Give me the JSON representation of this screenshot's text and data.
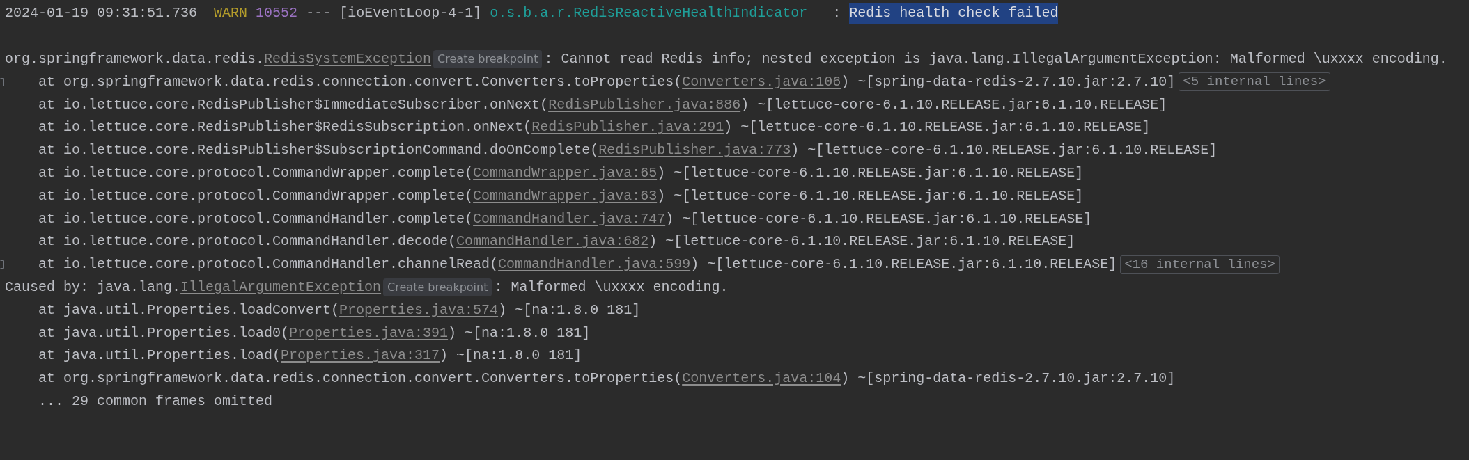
{
  "header": {
    "timestamp": "2024-01-19 09:31:51.736",
    "level": "WARN",
    "pid": "10552",
    "separator": "---",
    "thread": "[ioEventLoop-4-1]",
    "logger": "o.s.b.a.r.RedisReactiveHealthIndicator",
    "colon": ":",
    "message": "Redis health check failed",
    "message_selected": true
  },
  "lines": [
    {
      "kind": "exception",
      "prefix": "org.springframework.data.redis.",
      "class_link": "RedisSystemException",
      "hint": "Create breakpoint",
      "rest": ": Cannot read Redis info; nested exception is java.lang.IllegalArgumentException: Malformed \\uxxxx encoding."
    },
    {
      "kind": "frame",
      "fold_marker": true,
      "text": "at org.springframework.data.redis.connection.convert.Converters.toProperties(",
      "link": "Converters.java:106",
      "rest": ") ~[spring-data-redis-2.7.10.jar:2.7.10]",
      "folded": "<5 internal lines>"
    },
    {
      "kind": "frame",
      "fold_marker": false,
      "text": "at io.lettuce.core.RedisPublisher$ImmediateSubscriber.onNext(",
      "link": "RedisPublisher.java:886",
      "rest": ") ~[lettuce-core-6.1.10.RELEASE.jar:6.1.10.RELEASE]"
    },
    {
      "kind": "frame",
      "fold_marker": false,
      "text": "at io.lettuce.core.RedisPublisher$RedisSubscription.onNext(",
      "link": "RedisPublisher.java:291",
      "rest": ") ~[lettuce-core-6.1.10.RELEASE.jar:6.1.10.RELEASE]"
    },
    {
      "kind": "frame",
      "fold_marker": false,
      "text": "at io.lettuce.core.RedisPublisher$SubscriptionCommand.doOnComplete(",
      "link": "RedisPublisher.java:773",
      "rest": ") ~[lettuce-core-6.1.10.RELEASE.jar:6.1.10.RELEASE]"
    },
    {
      "kind": "frame",
      "fold_marker": false,
      "text": "at io.lettuce.core.protocol.CommandWrapper.complete(",
      "link": "CommandWrapper.java:65",
      "rest": ") ~[lettuce-core-6.1.10.RELEASE.jar:6.1.10.RELEASE]"
    },
    {
      "kind": "frame",
      "fold_marker": false,
      "text": "at io.lettuce.core.protocol.CommandWrapper.complete(",
      "link": "CommandWrapper.java:63",
      "rest": ") ~[lettuce-core-6.1.10.RELEASE.jar:6.1.10.RELEASE]"
    },
    {
      "kind": "frame",
      "fold_marker": false,
      "text": "at io.lettuce.core.protocol.CommandHandler.complete(",
      "link": "CommandHandler.java:747",
      "rest": ") ~[lettuce-core-6.1.10.RELEASE.jar:6.1.10.RELEASE]"
    },
    {
      "kind": "frame",
      "fold_marker": false,
      "text": "at io.lettuce.core.protocol.CommandHandler.decode(",
      "link": "CommandHandler.java:682",
      "rest": ") ~[lettuce-core-6.1.10.RELEASE.jar:6.1.10.RELEASE]"
    },
    {
      "kind": "frame",
      "fold_marker": true,
      "text": "at io.lettuce.core.protocol.CommandHandler.channelRead(",
      "link": "CommandHandler.java:599",
      "rest": ") ~[lettuce-core-6.1.10.RELEASE.jar:6.1.10.RELEASE]",
      "folded": "<16 internal lines>"
    },
    {
      "kind": "exception",
      "prefix": "Caused by: java.lang.",
      "class_link": "IllegalArgumentException",
      "hint": "Create breakpoint",
      "rest": ": Malformed \\uxxxx encoding."
    },
    {
      "kind": "frame",
      "fold_marker": false,
      "text": "at java.util.Properties.loadConvert(",
      "link": "Properties.java:574",
      "rest": ") ~[na:1.8.0_181]"
    },
    {
      "kind": "frame",
      "fold_marker": false,
      "text": "at java.util.Properties.load0(",
      "link": "Properties.java:391",
      "rest": ") ~[na:1.8.0_181]"
    },
    {
      "kind": "frame",
      "fold_marker": false,
      "text": "at java.util.Properties.load(",
      "link": "Properties.java:317",
      "rest": ") ~[na:1.8.0_181]"
    },
    {
      "kind": "frame",
      "fold_marker": false,
      "text": "at org.springframework.data.redis.connection.convert.Converters.toProperties(",
      "link": "Converters.java:104",
      "rest": ") ~[spring-data-redis-2.7.10.jar:2.7.10]"
    },
    {
      "kind": "omitted",
      "text": "... 29 common frames omitted"
    }
  ]
}
